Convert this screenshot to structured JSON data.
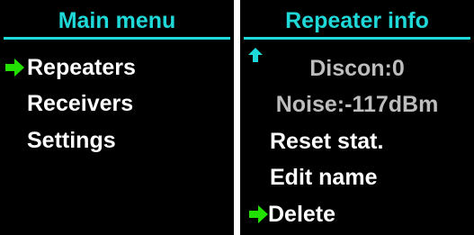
{
  "colors": {
    "screen_bg": "#000000",
    "title_text": "#1fd8d8",
    "title_rule": "#1fd8d8",
    "item_text": "#ffffff",
    "dim_text": "#bdbdbd",
    "cursor_arrow": "#22e000",
    "scroll_arrow": "#1fd8d8"
  },
  "main_menu": {
    "title": "Main menu",
    "cursor_icon": "right-arrow",
    "items": [
      {
        "label": "Repeaters",
        "selected": true
      },
      {
        "label": "Receivers",
        "selected": false
      },
      {
        "label": "Settings",
        "selected": false
      }
    ]
  },
  "repeater_info": {
    "title": "Repeater info",
    "scroll_icon": "up-arrow",
    "cursor_icon": "right-arrow",
    "items": [
      {
        "label": "Discon:0",
        "selected": false
      },
      {
        "label": "Noise:-117dBm",
        "selected": false
      },
      {
        "label": "Reset stat.",
        "selected": false
      },
      {
        "label": "Edit name",
        "selected": false
      },
      {
        "label": "Delete",
        "selected": true
      }
    ]
  }
}
